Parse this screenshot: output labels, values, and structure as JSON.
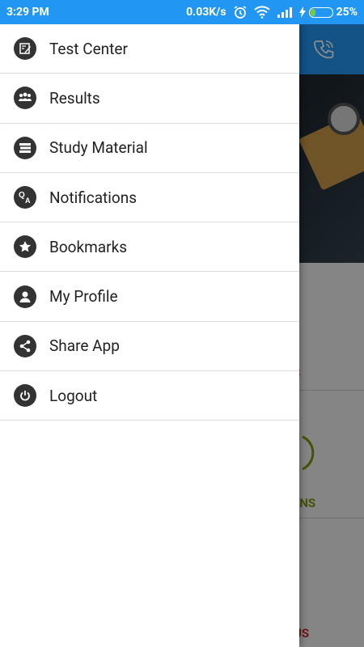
{
  "status_bar": {
    "time": "3:29 PM",
    "network_speed": "0.03K/s",
    "battery_percent": "25%",
    "battery_level": 0.25,
    "icons": [
      "alarm-icon",
      "wifi-icon",
      "signal-icon",
      "charging-icon",
      "battery-icon"
    ]
  },
  "drawer": {
    "items": [
      {
        "label": "Test Center",
        "icon": "test-center-icon"
      },
      {
        "label": "Results",
        "icon": "results-icon"
      },
      {
        "label": "Study Material",
        "icon": "study-material-icon"
      },
      {
        "label": "Notifications",
        "icon": "notifications-qa-icon"
      },
      {
        "label": "Bookmarks",
        "icon": "star-icon"
      },
      {
        "label": "My Profile",
        "icon": "profile-icon"
      },
      {
        "label": "Share App",
        "icon": "share-icon"
      },
      {
        "label": "Logout",
        "icon": "power-icon"
      }
    ]
  },
  "background": {
    "toolbar_color": "#2196f3",
    "visible_text_fragments": [
      "S",
      "ONS",
      "US"
    ]
  },
  "colors": {
    "accent": "#2196f3",
    "icon_bg": "#333333",
    "fragment_red": "#c62828",
    "fragment_green": "#7a9a01"
  }
}
